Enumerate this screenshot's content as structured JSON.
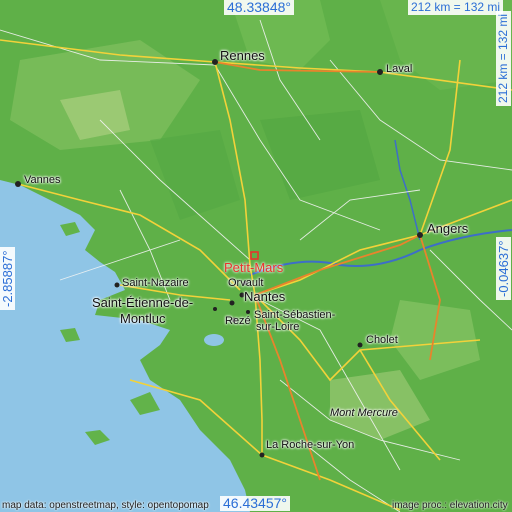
{
  "map": {
    "lat_top": "48.33848°",
    "lat_bottom": "46.43457°",
    "lon_left": "-2.85887°",
    "lon_right": "-0.04637°",
    "scale_top": "212 km = 132 mi",
    "scale_right": "212 km = 132 mi"
  },
  "marker": {
    "label": "Petit-Mars",
    "color": "#e8332c"
  },
  "cities": {
    "rennes": "Rennes",
    "laval": "Laval",
    "vannes": "Vannes",
    "angers": "Angers",
    "saint_nazaire": "Saint-Nazaire",
    "saint_etienne_1": "Saint-Étienne-de-",
    "saint_etienne_2": "Montluc",
    "orvault": "Orvault",
    "nantes": "Nantes",
    "reze": "Rezé",
    "saint_sebastien_1": "Saint-Sébastien-",
    "saint_sebastien_2": "sur-Loire",
    "cholet": "Cholet",
    "mont_mercure": "Mont Mercure",
    "la_roche": "La Roche-sur-Yon"
  },
  "credits": {
    "left": "map data: openstreetmap, style: opentopomap",
    "right": "image proc.: elevation.city"
  },
  "colors": {
    "sea": "#8fc5e6",
    "land": "#62b34a",
    "coord_text": "#2b6ed6"
  }
}
